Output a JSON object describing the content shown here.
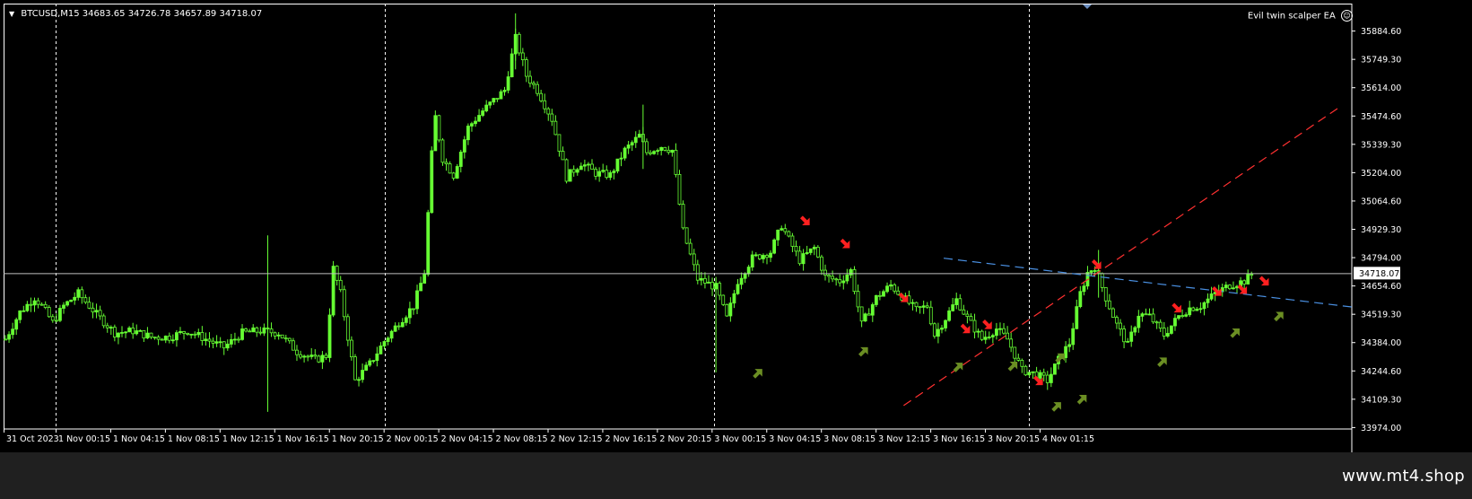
{
  "window": {
    "symbol": "BTCUSD,M15",
    "ohlc": "34683.65 34726.78 34657.89 34718.07",
    "indicator": "Evil twin scalper EA"
  },
  "colors": {
    "background": "#000000",
    "candle": "#66ff33",
    "grid": "#ffffff",
    "bid_line": "#c0c0c0",
    "sell_arrow": "#ff2020",
    "buy_arrow": "#6b8e23",
    "trend_up": "#ff3030",
    "trend_down": "#4a90e2"
  },
  "icons": {
    "sell": "arrow-down-right-icon",
    "buy": "arrow-up-right-icon"
  },
  "price_axis": {
    "labels": [
      "35884.60",
      "35749.30",
      "35614.00",
      "35474.60",
      "35339.30",
      "35204.00",
      "35064.60",
      "34929.30",
      "34794.00",
      "34654.60",
      "34519.30",
      "34384.00",
      "34244.60",
      "34109.30",
      "33974.00"
    ],
    "current": "34718.07"
  },
  "time_axis": {
    "labels": [
      "31 Oct 2023",
      "1 Nov 00:15",
      "1 Nov 04:15",
      "1 Nov 08:15",
      "1 Nov 12:15",
      "1 Nov 16:15",
      "1 Nov 20:15",
      "2 Nov 00:15",
      "2 Nov 04:15",
      "2 Nov 08:15",
      "2 Nov 12:15",
      "2 Nov 16:15",
      "2 Nov 20:15",
      "3 Nov 00:15",
      "3 Nov 04:15",
      "3 Nov 08:15",
      "3 Nov 12:15",
      "3 Nov 16:15",
      "3 Nov 20:15",
      "4 Nov 01:15"
    ]
  },
  "chart_data": {
    "type": "candlestick",
    "symbol": "BTCUSD",
    "timeframe": "M15",
    "ylim": [
      33974.0,
      35884.6
    ],
    "current_price": 34718.07,
    "path": [
      [
        0,
        34400
      ],
      [
        4,
        34530
      ],
      [
        8,
        34600
      ],
      [
        10,
        34560
      ],
      [
        13,
        34480
      ],
      [
        16,
        34560
      ],
      [
        20,
        34620
      ],
      [
        25,
        34520
      ],
      [
        30,
        34430
      ],
      [
        35,
        34440
      ],
      [
        40,
        34410
      ],
      [
        45,
        34410
      ],
      [
        50,
        34440
      ],
      [
        55,
        34400
      ],
      [
        60,
        34360
      ],
      [
        65,
        34430
      ],
      [
        70,
        34440
      ],
      [
        75,
        34430
      ],
      [
        80,
        34340
      ],
      [
        85,
        34300
      ],
      [
        88,
        34320
      ],
      [
        90,
        34740
      ],
      [
        92,
        34620
      ],
      [
        96,
        34200
      ],
      [
        100,
        34280
      ],
      [
        104,
        34390
      ],
      [
        108,
        34480
      ],
      [
        112,
        34560
      ],
      [
        115,
        34720
      ],
      [
        117,
        35290
      ],
      [
        118,
        35470
      ],
      [
        120,
        35270
      ],
      [
        123,
        35190
      ],
      [
        127,
        35420
      ],
      [
        131,
        35500
      ],
      [
        134,
        35550
      ],
      [
        137,
        35600
      ],
      [
        140,
        35850
      ],
      [
        143,
        35670
      ],
      [
        146,
        35600
      ],
      [
        150,
        35460
      ],
      [
        154,
        35180
      ],
      [
        158,
        35250
      ],
      [
        162,
        35200
      ],
      [
        166,
        35190
      ],
      [
        170,
        35310
      ],
      [
        174,
        35380
      ],
      [
        176,
        35300
      ],
      [
        180,
        35330
      ],
      [
        183,
        35310
      ],
      [
        186,
        34920
      ],
      [
        190,
        34690
      ],
      [
        195,
        34650
      ],
      [
        198,
        34500
      ],
      [
        201,
        34680
      ],
      [
        205,
        34790
      ],
      [
        210,
        34820
      ],
      [
        213,
        34950
      ],
      [
        215,
        34880
      ],
      [
        218,
        34780
      ],
      [
        222,
        34840
      ],
      [
        225,
        34700
      ],
      [
        229,
        34680
      ],
      [
        232,
        34730
      ],
      [
        235,
        34470
      ],
      [
        239,
        34600
      ],
      [
        243,
        34660
      ],
      [
        247,
        34590
      ],
      [
        250,
        34540
      ],
      [
        253,
        34560
      ],
      [
        255,
        34420
      ],
      [
        258,
        34500
      ],
      [
        261,
        34590
      ],
      [
        264,
        34500
      ],
      [
        268,
        34400
      ],
      [
        272,
        34450
      ],
      [
        275,
        34400
      ],
      [
        279,
        34250
      ],
      [
        283,
        34230
      ],
      [
        286,
        34200
      ],
      [
        289,
        34300
      ],
      [
        292,
        34380
      ],
      [
        295,
        34620
      ],
      [
        297,
        34720
      ],
      [
        299,
        34750
      ],
      [
        302,
        34600
      ],
      [
        305,
        34470
      ],
      [
        308,
        34370
      ],
      [
        311,
        34520
      ],
      [
        314,
        34510
      ],
      [
        318,
        34420
      ],
      [
        322,
        34510
      ],
      [
        325,
        34550
      ],
      [
        328,
        34560
      ],
      [
        332,
        34620
      ],
      [
        336,
        34660
      ],
      [
        340,
        34680
      ],
      [
        342,
        34710
      ]
    ]
  },
  "markers": {
    "sell": [
      [
        220,
        34970
      ],
      [
        231,
        34860
      ],
      [
        247,
        34600
      ],
      [
        264,
        34450
      ],
      [
        270,
        34470
      ],
      [
        284,
        34200
      ],
      [
        300,
        34760
      ],
      [
        322,
        34550
      ],
      [
        333,
        34630
      ],
      [
        340,
        34640
      ],
      [
        346,
        34680
      ]
    ],
    "buy": [
      [
        207,
        34235
      ],
      [
        236,
        34340
      ],
      [
        262,
        34265
      ],
      [
        277,
        34270
      ],
      [
        290,
        34310
      ],
      [
        289,
        34075
      ],
      [
        296,
        34110
      ],
      [
        318,
        34290
      ],
      [
        338,
        34430
      ],
      [
        350,
        34510
      ]
    ]
  }
}
